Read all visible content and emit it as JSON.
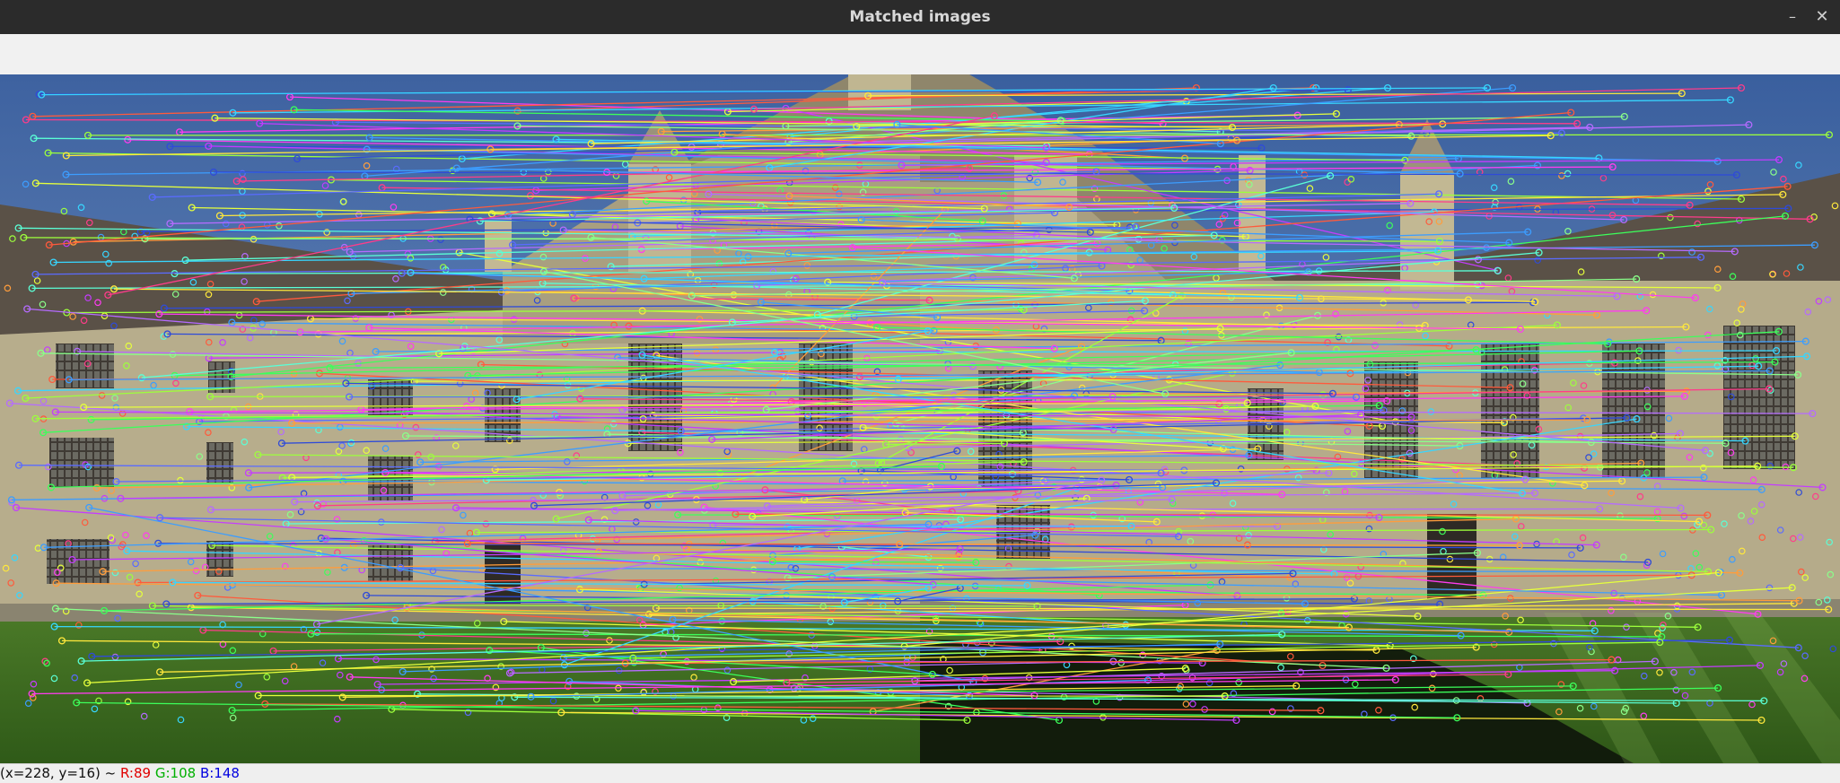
{
  "window": {
    "title": "Matched images",
    "minimize_symbol": "–",
    "close_symbol": "✕"
  },
  "status": {
    "coords": "(x=228, y=16) ~",
    "r": "R:89",
    "g": "G:108",
    "b": "B:148"
  },
  "colors": {
    "sky": "#5e87b8",
    "grass": "#3d6a22",
    "stone": "#b3a98a",
    "status_r": "#e00000",
    "status_g": "#00b000",
    "status_b": "#0000e0"
  }
}
